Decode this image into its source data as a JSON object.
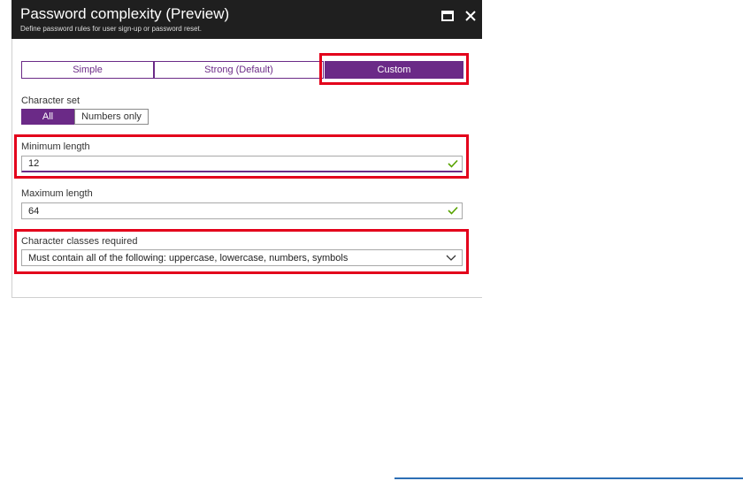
{
  "header": {
    "title": "Password complexity (Preview)",
    "subtitle": "Define password rules for user sign-up or password reset.",
    "maximize_icon": "maximize-icon",
    "close_icon": "close-icon"
  },
  "complexity_tabs": {
    "items": [
      {
        "label": "Simple",
        "selected": false
      },
      {
        "label": "Strong (Default)",
        "selected": false
      },
      {
        "label": "Custom",
        "selected": true
      }
    ]
  },
  "character_set": {
    "label": "Character set",
    "options": [
      {
        "label": "All",
        "selected": true
      },
      {
        "label": "Numbers only",
        "selected": false
      }
    ]
  },
  "minimum_length": {
    "label": "Minimum length",
    "value": "12",
    "valid_icon": "checkmark-icon"
  },
  "maximum_length": {
    "label": "Maximum length",
    "value": "64",
    "valid_icon": "checkmark-icon"
  },
  "character_classes": {
    "label": "Character classes required",
    "value": "Must contain all of the following: uppercase, lowercase, numbers, symbols",
    "dropdown_icon": "chevron-down-icon"
  },
  "colors": {
    "accent": "#6b2a87",
    "highlight": "#e3001b",
    "title_bar": "#1f1f1f",
    "valid_check": "#57a300"
  }
}
